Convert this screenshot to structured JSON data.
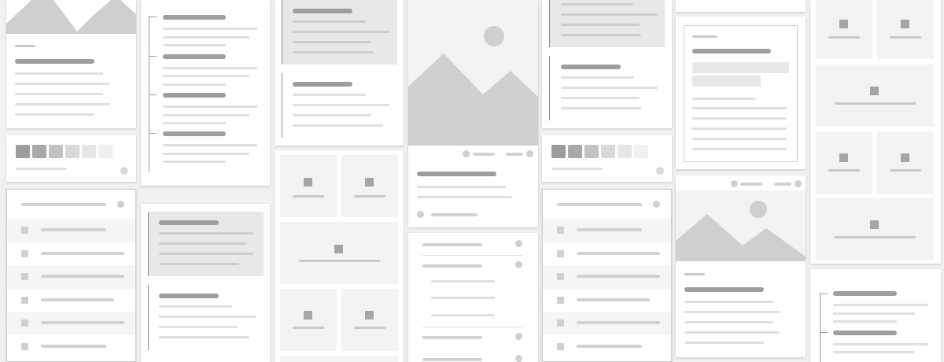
{
  "theme": {
    "background": "#f1f1f1",
    "card": "#ffffff",
    "placeholder_dark": "#9e9e9e",
    "placeholder_light": "#e0e0e0",
    "image_fill": "#cfcfcf",
    "palette": [
      "#9c9c9c",
      "#a9a9a9",
      "#c2c2c2",
      "#d8d8d8",
      "#e6e6e6",
      "#f0f0f0"
    ]
  },
  "icons": [
    "image-placeholder-icon",
    "dot-icon",
    "square-placeholder-icon",
    "checkbox-icon"
  ]
}
